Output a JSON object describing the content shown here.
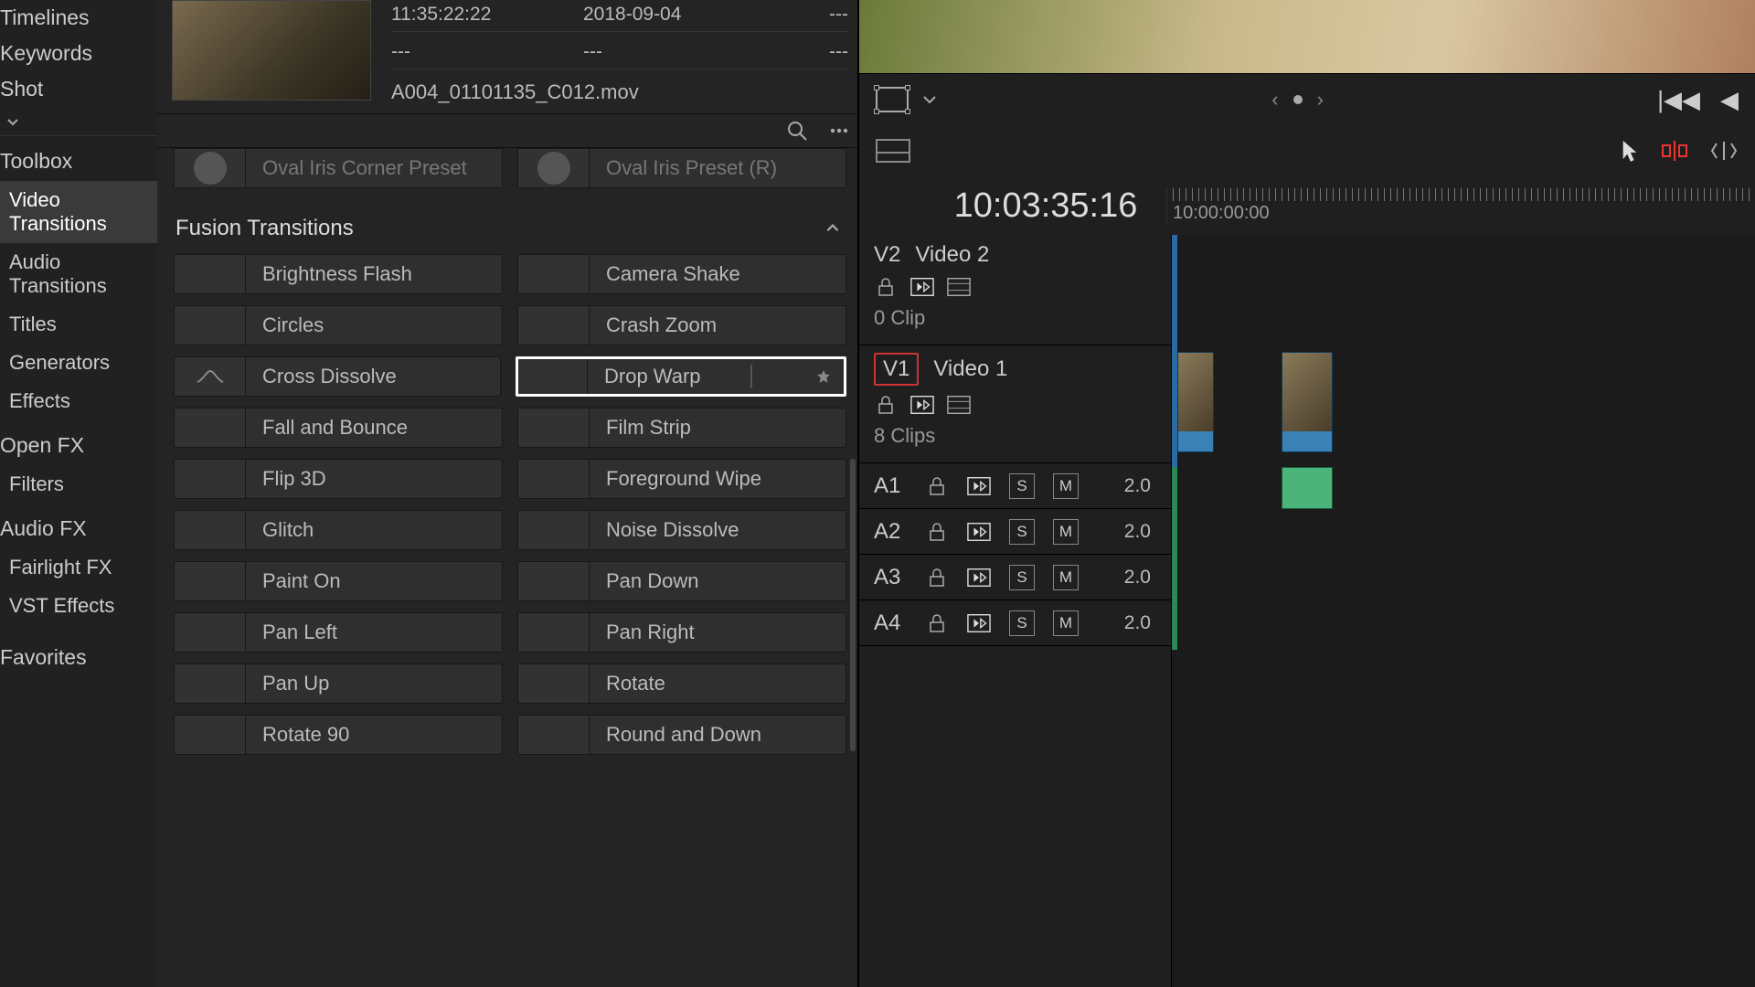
{
  "sidebar": {
    "smarts": [
      "Timelines",
      "Keywords",
      "Shot"
    ],
    "categories": {
      "toolbox": "Toolbox",
      "toolbox_items": [
        {
          "label": "Video Transitions",
          "active": true
        },
        {
          "label": "Audio Transitions",
          "active": false
        },
        {
          "label": "Titles",
          "active": false
        },
        {
          "label": "Generators",
          "active": false
        },
        {
          "label": "Effects",
          "active": false
        }
      ],
      "openfx": "Open FX",
      "openfx_items": [
        {
          "label": "Filters"
        }
      ],
      "audiofx": "Audio FX",
      "audiofx_items": [
        {
          "label": "Fairlight FX"
        },
        {
          "label": "VST Effects"
        }
      ]
    },
    "favorites_label": "Favorites"
  },
  "clipMeta": {
    "rows": [
      {
        "c1": "11:35:22:22",
        "c2": "2018-09-04",
        "c3": "---"
      },
      {
        "c1": "---",
        "c2": "---",
        "c3": "---"
      }
    ],
    "filename": "A004_01101135_C012.mov"
  },
  "irisRow": [
    {
      "label": "Oval Iris Corner Preset"
    },
    {
      "label": "Oval Iris Preset (R)"
    }
  ],
  "fusionHeader": "Fusion Transitions",
  "fusion": [
    [
      {
        "label": "Brightness Flash"
      },
      {
        "label": "Camera Shake"
      }
    ],
    [
      {
        "label": "Circles"
      },
      {
        "label": "Crash Zoom"
      }
    ],
    [
      {
        "label": "Cross Dissolve",
        "icon": "crossd"
      },
      {
        "label": "Drop Warp",
        "selected": true
      }
    ],
    [
      {
        "label": "Fall and Bounce"
      },
      {
        "label": "Film Strip"
      }
    ],
    [
      {
        "label": "Flip 3D"
      },
      {
        "label": "Foreground Wipe"
      }
    ],
    [
      {
        "label": "Glitch"
      },
      {
        "label": "Noise Dissolve",
        "swatch": "noise"
      }
    ],
    [
      {
        "label": "Paint On"
      },
      {
        "label": "Pan Down"
      }
    ],
    [
      {
        "label": "Pan Left"
      },
      {
        "label": "Pan Right"
      }
    ],
    [
      {
        "label": "Pan Up"
      },
      {
        "label": "Rotate"
      }
    ],
    [
      {
        "label": "Rotate 90"
      },
      {
        "label": "Round and Down"
      }
    ]
  ],
  "right": {
    "timecode": "10:03:35:16",
    "rulerStart": "10:00:00:00",
    "vtracks": [
      {
        "tag": "V2",
        "name": "Video 2",
        "clips": "0 Clip",
        "boxed": false
      },
      {
        "tag": "V1",
        "name": "Video 1",
        "clips": "8 Clips",
        "boxed": true
      }
    ],
    "atracks": [
      {
        "tag": "A1",
        "ch": "2.0"
      },
      {
        "tag": "A2",
        "ch": "2.0"
      },
      {
        "tag": "A3",
        "ch": "2.0"
      },
      {
        "tag": "A4",
        "ch": "2.0"
      }
    ],
    "s_label": "S",
    "m_label": "M"
  }
}
